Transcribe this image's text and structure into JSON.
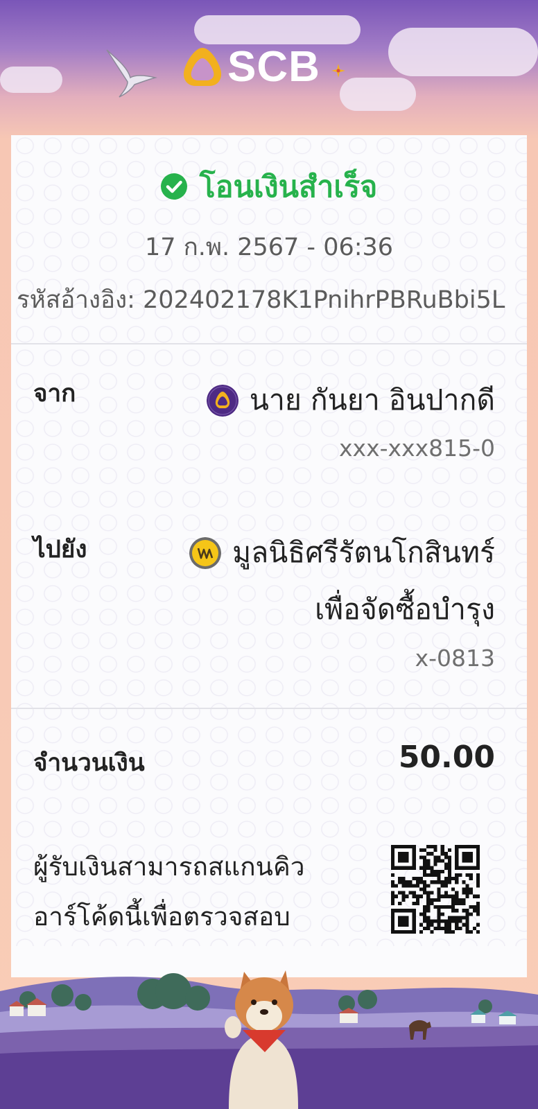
{
  "brand": {
    "name": "SCB"
  },
  "status": {
    "text": "โอนเงินสำเร็จ",
    "icon": "check-circle-icon",
    "color": "#27b24c"
  },
  "transaction": {
    "datetime": "17 ก.พ. 2567 - 06:36",
    "reference": "รหัสอ้างอิง: 202402178K1PnihrPBRuBbi5L"
  },
  "from": {
    "label": "จาก",
    "name": "นาย กันยา อินปากดี",
    "account": "xxx-xxx815-0",
    "bank_icon": "scb-bank-icon"
  },
  "to": {
    "label": "ไปยัง",
    "name_line1": "มูลนิธิศรีรัตนโกสินทร์",
    "name_line2": "เพื่อจัดซื้อบำรุง",
    "account": "x-0813",
    "bank_icon": "krungsri-bank-icon"
  },
  "amount": {
    "label": "จำนวนเงิน",
    "value": "50.00"
  },
  "qr": {
    "note_line1": "ผู้รับเงินสามารถสแกนคิว",
    "note_line2": "อาร์โค้ดนี้เพื่อตรวจสอบ",
    "icon": "qr-code-icon"
  },
  "colors": {
    "brand_purple": "#4e2a84",
    "success_green": "#27b24c",
    "logo_gold": "#f2b01e"
  }
}
